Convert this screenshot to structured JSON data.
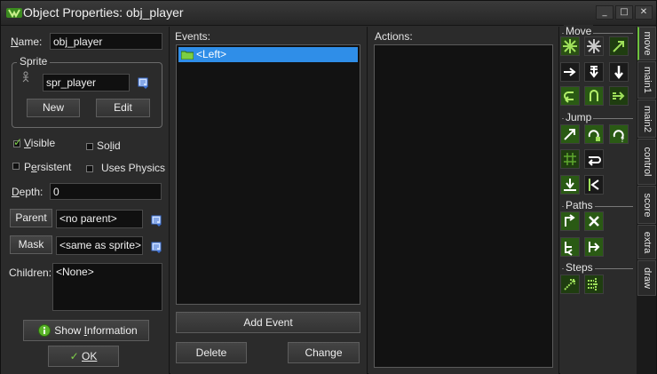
{
  "window": {
    "title": "Object Properties: obj_player",
    "minimize": "_",
    "maximize": "□",
    "close": "✕"
  },
  "left": {
    "name_label": "Name:",
    "name_value": "obj_player",
    "sprite_group": "Sprite",
    "sprite_value": "spr_player",
    "new_button": "New",
    "edit_button": "Edit",
    "visible_label": "Visible",
    "visible_checked": true,
    "solid_label": "Solid",
    "solid_checked": false,
    "persistent_label": "Persistent",
    "persistent_checked": false,
    "physics_label": "Uses Physics",
    "physics_checked": false,
    "depth_label": "Depth:",
    "depth_value": "0",
    "parent_button": "Parent",
    "parent_value": "<no parent>",
    "mask_button": "Mask",
    "mask_value": "<same as sprite>",
    "children_label": "Children:",
    "children_value": "<None>",
    "show_info_button": "Show Information",
    "ok_button": "OK"
  },
  "events": {
    "label": "Events:",
    "items": [
      "<Left>"
    ],
    "add_event_button": "Add Event",
    "delete_button": "Delete",
    "change_button": "Change"
  },
  "actions": {
    "label": "Actions:"
  },
  "palette": {
    "sections": {
      "move": "Move",
      "jump": "Jump",
      "paths": "Paths",
      "steps": "Steps"
    }
  },
  "tabs": [
    "move",
    "main1",
    "main2",
    "control",
    "score",
    "extra",
    "draw"
  ],
  "colors": {
    "accent": "#6ec23e",
    "selection": "#2f8ee8",
    "background": "#2b2b2b"
  }
}
